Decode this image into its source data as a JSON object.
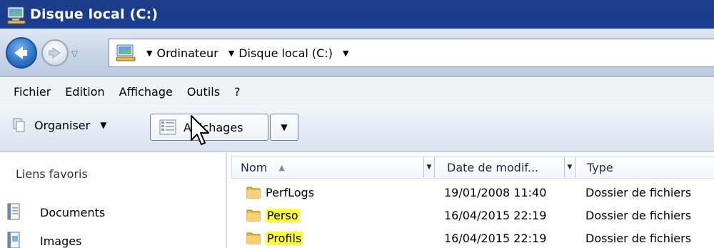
{
  "window": {
    "title": "Disque local (C:)"
  },
  "address": {
    "breadcrumbs": [
      "Ordinateur",
      "Disque local (C:)"
    ]
  },
  "menu": [
    "Fichier",
    "Edition",
    "Affichage",
    "Outils",
    "?"
  ],
  "toolbar": {
    "organiser_label": "Organiser",
    "affichages_label": "Affichages"
  },
  "favorites": {
    "title": "Liens favoris",
    "items": [
      "Documents",
      "Images"
    ]
  },
  "columns": {
    "name": "Nom",
    "date": "Date de modif...",
    "type": "Type"
  },
  "files": [
    {
      "name": "PerfLogs",
      "date": "19/01/2008 11:40",
      "type": "Dossier de fichiers",
      "highlighted": false
    },
    {
      "name": "Perso",
      "date": "16/04/2015 22:19",
      "type": "Dossier de fichiers",
      "highlighted": true
    },
    {
      "name": "Profils",
      "date": "16/04/2015 22:19",
      "type": "Dossier de fichiers",
      "highlighted": true
    }
  ],
  "colors": {
    "titlebar": "#1b3f93",
    "highlight": "#ffff33",
    "folder": "#f0c14b"
  },
  "icons": {
    "app": "computer-drive-icon",
    "back": "back-arrow-icon",
    "forward": "forward-arrow-icon",
    "computer": "computer-icon",
    "organiser": "organise-icon",
    "views": "views-icon",
    "folder": "folder-icon",
    "documents": "documents-icon",
    "images": "images-icon",
    "cursor": "mouse-cursor-icon"
  }
}
